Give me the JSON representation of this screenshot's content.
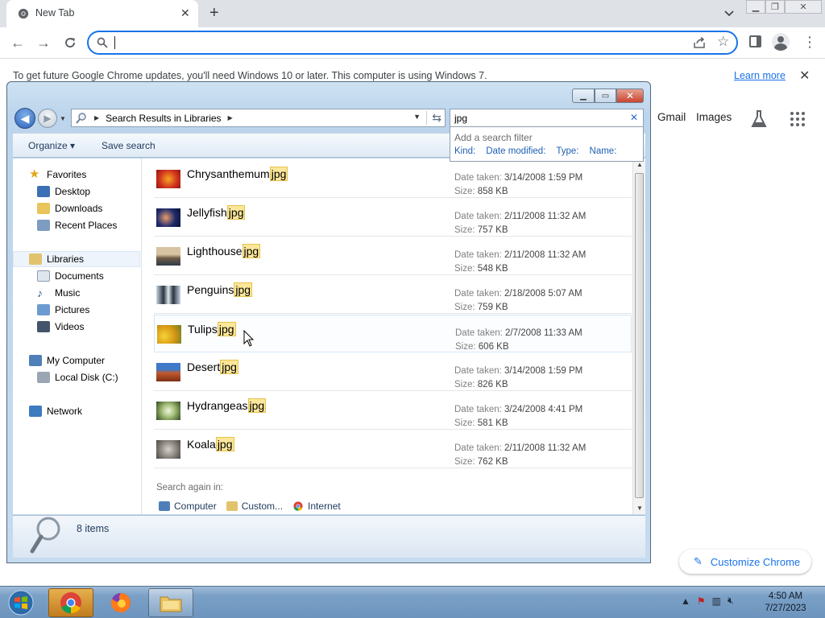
{
  "chrome": {
    "tab_title": "New Tab",
    "tab_close": "✕",
    "new_tab": "+",
    "omnibox_value": "",
    "infobar_message": "To get future Google Chrome updates, you'll need Windows 10 or later. This computer is using Windows 7.",
    "infobar_link": "Learn more",
    "infobar_close": "✕"
  },
  "ntp": {
    "links": [
      "Gmail",
      "Images"
    ],
    "customize_label": "Customize Chrome"
  },
  "explorer": {
    "breadcrumb": "Search Results in Libraries",
    "search_value": "jpg",
    "filter": {
      "header": "Add a search filter",
      "kinds": [
        "Kind:",
        "Date modified:",
        "Type:",
        "Name:"
      ]
    },
    "commands": {
      "organize": "Organize ▾",
      "save_search": "Save search"
    },
    "nav": {
      "favorites": "Favorites",
      "desktop": "Desktop",
      "downloads": "Downloads",
      "recent": "Recent Places",
      "libraries": "Libraries",
      "documents": "Documents",
      "music": "Music",
      "pictures": "Pictures",
      "videos": "Videos",
      "computer": "My Computer",
      "localdisk": "Local Disk (C:)",
      "network": "Network"
    },
    "date_label": "Date taken:",
    "size_label": "Size:",
    "files": [
      {
        "base": "Chrysanthemum",
        "ext": "jpg",
        "date": "3/14/2008 1:59 PM",
        "size": "858 KB"
      },
      {
        "base": "Jellyfish",
        "ext": "jpg",
        "date": "2/11/2008 11:32 AM",
        "size": "757 KB"
      },
      {
        "base": "Lighthouse",
        "ext": "jpg",
        "date": "2/11/2008 11:32 AM",
        "size": "548 KB"
      },
      {
        "base": "Penguins",
        "ext": "jpg",
        "date": "2/18/2008 5:07 AM",
        "size": "759 KB"
      },
      {
        "base": "Tulips",
        "ext": "jpg",
        "date": "2/7/2008 11:33 AM",
        "size": "606 KB"
      },
      {
        "base": "Desert",
        "ext": "jpg",
        "date": "3/14/2008 1:59 PM",
        "size": "826 KB"
      },
      {
        "base": "Hydrangeas",
        "ext": "jpg",
        "date": "3/24/2008 4:41 PM",
        "size": "581 KB"
      },
      {
        "base": "Koala",
        "ext": "jpg",
        "date": "2/11/2008 11:32 AM",
        "size": "762 KB"
      }
    ],
    "search_again": "Search again in:",
    "search_again_links": [
      "Computer",
      "Custom...",
      "Internet"
    ],
    "item_count": "8 items"
  },
  "taskbar": {
    "time": "4:50 AM",
    "date": "7/27/2023"
  },
  "colors": {
    "accent": "#1a73e8",
    "highlight": "#fbe79a"
  }
}
